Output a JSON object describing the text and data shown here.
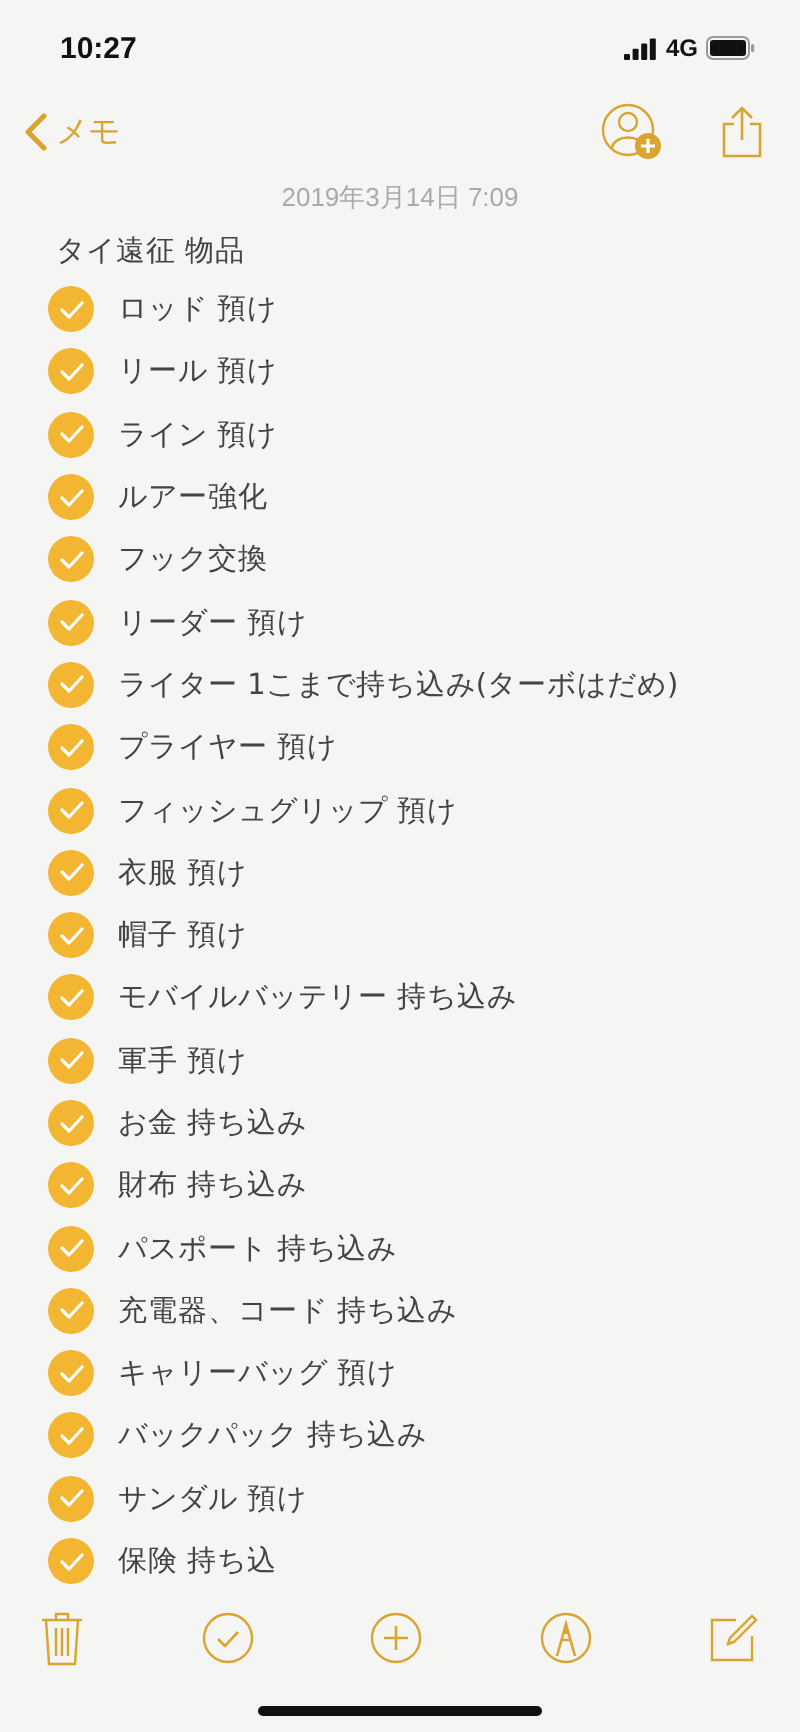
{
  "status_bar": {
    "time": "10:27",
    "network": "4G"
  },
  "nav": {
    "back_label": "メモ"
  },
  "note": {
    "date": "2019年3月14日 7:09",
    "title": "タイ遠征 物品",
    "items": [
      {
        "text": "ロッド 預け",
        "checked": true
      },
      {
        "text": "リール 預け",
        "checked": true
      },
      {
        "text": "ライン 預け",
        "checked": true
      },
      {
        "text": "ルアー強化",
        "checked": true
      },
      {
        "text": "フック交換",
        "checked": true
      },
      {
        "text": "リーダー 預け",
        "checked": true
      },
      {
        "text": "ライター 1こまで持ち込み(ターボはだめ)",
        "checked": true
      },
      {
        "text": "プライヤー 預け",
        "checked": true
      },
      {
        "text": "フィッシュグリップ 預け",
        "checked": true
      },
      {
        "text": "衣服 預け",
        "checked": true
      },
      {
        "text": "帽子 預け",
        "checked": true
      },
      {
        "text": "モバイルバッテリー 持ち込み",
        "checked": true
      },
      {
        "text": "軍手 預け",
        "checked": true
      },
      {
        "text": "お金 持ち込み",
        "checked": true
      },
      {
        "text": "財布 持ち込み",
        "checked": true
      },
      {
        "text": "パスポート 持ち込み",
        "checked": true
      },
      {
        "text": "充電器、コード  持ち込み",
        "checked": true
      },
      {
        "text": "キャリーバッグ 預け",
        "checked": true
      },
      {
        "text": "バックパック 持ち込み",
        "checked": true
      },
      {
        "text": "サンダル 預け",
        "checked": true
      },
      {
        "text": "保険 持ち込",
        "checked": true
      }
    ]
  }
}
